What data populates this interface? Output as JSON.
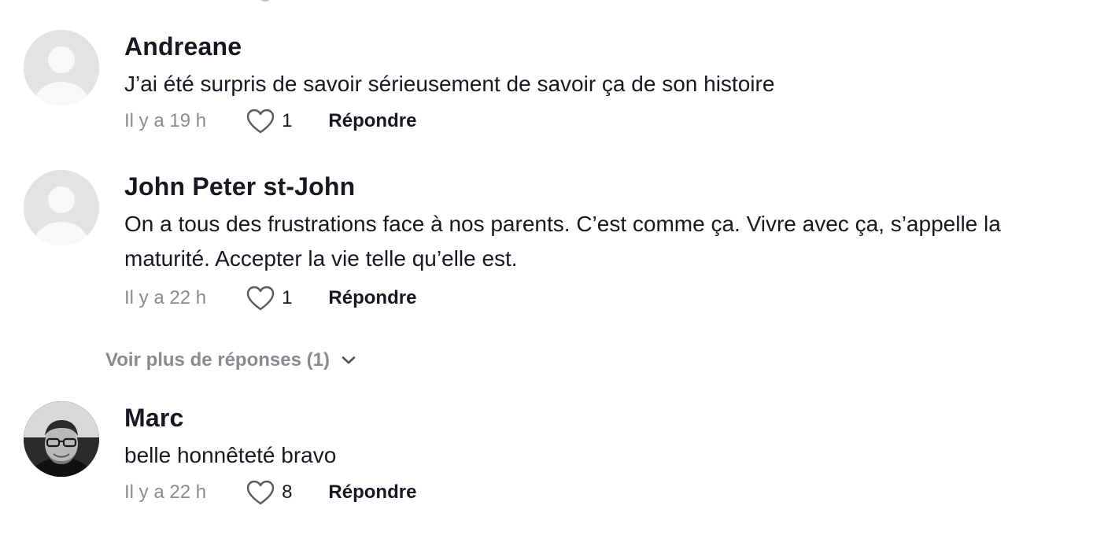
{
  "comments": [
    {
      "author": "Andreane",
      "text_lines": [
        "J’ai été surpris de savoir sérieusement de savoir ça de son histoire"
      ],
      "time": "Il y a 19 h",
      "likes": "1",
      "reply_label": "Répondre",
      "avatar": "default-avatar-icon"
    },
    {
      "author": "John Peter st-John",
      "text_lines": [
        "On a tous des frustrations face à nos parents. C’est comme ça. Vivre avec ça, s’appelle la",
        "maturité. Accepter la vie telle qu’elle est."
      ],
      "time": "Il y a 22 h",
      "likes": "1",
      "reply_label": "Répondre",
      "avatar": "default-avatar-icon"
    },
    {
      "author": "Marc",
      "text_lines": [
        "belle honnêteté bravo"
      ],
      "time": "Il y a 22 h",
      "likes": "8",
      "reply_label": "Répondre",
      "avatar": "user-photo"
    }
  ],
  "more_replies": {
    "label": "Voir plus de réponses (1)"
  },
  "icons": {
    "like": "heart-outline-icon",
    "expand": "chevron-down-icon"
  },
  "colors": {
    "primary_text": "#161823",
    "secondary_text": "#8a8b91",
    "avatar_placeholder_bg": "#e3e3e4"
  }
}
